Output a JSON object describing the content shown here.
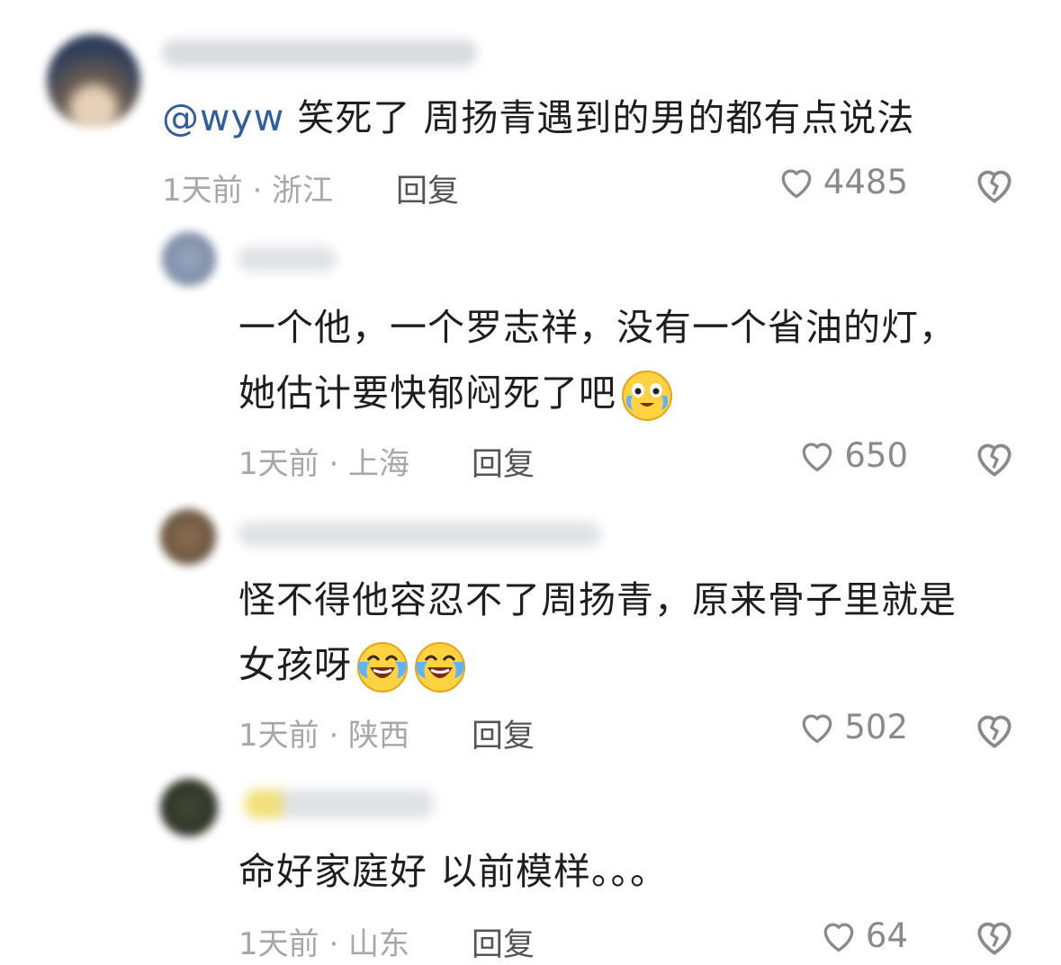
{
  "comments": [
    {
      "mention": "@wyw",
      "text": " 笑死了 周扬青遇到的男的都有点说法",
      "time_location": "1天前 · 浙江",
      "reply": "回复",
      "likes": "4485",
      "avatar_colors": [
        "#2f3e5a",
        "#8a7a6a",
        "#e6d0b8"
      ]
    },
    {
      "line1": "一个他，一个罗志祥，没有一个省油的灯，",
      "line2": "她估计要快郁闷死了吧",
      "emoji": "crying-face",
      "time_location": "1天前 · 上海",
      "reply": "回复",
      "likes": "650",
      "avatar_colors": [
        "#9aa8c0",
        "#6f7f99"
      ]
    },
    {
      "line1": "怪不得他容忍不了周扬青，原来骨子里就是",
      "line2": "女孩呀",
      "emoji": "laughing-crying-face",
      "time_location": "1天前 · 陕西",
      "reply": "回复",
      "likes": "502",
      "avatar_colors": [
        "#8a6e52",
        "#5e4a36"
      ]
    },
    {
      "line1": "命好家庭好 以前模样。。。",
      "time_location": "1天前 · 山东",
      "reply": "回复",
      "likes": "64",
      "avatar_colors": [
        "#3f4836",
        "#262b22"
      ]
    }
  ],
  "colors": {
    "mention": "#2f5d9e",
    "text": "#1e1e1e",
    "meta": "#a7a7a7",
    "icon": "#8a8a8a"
  },
  "icons": {
    "like": "heart-outline-icon",
    "dislike": "broken-heart-icon"
  }
}
